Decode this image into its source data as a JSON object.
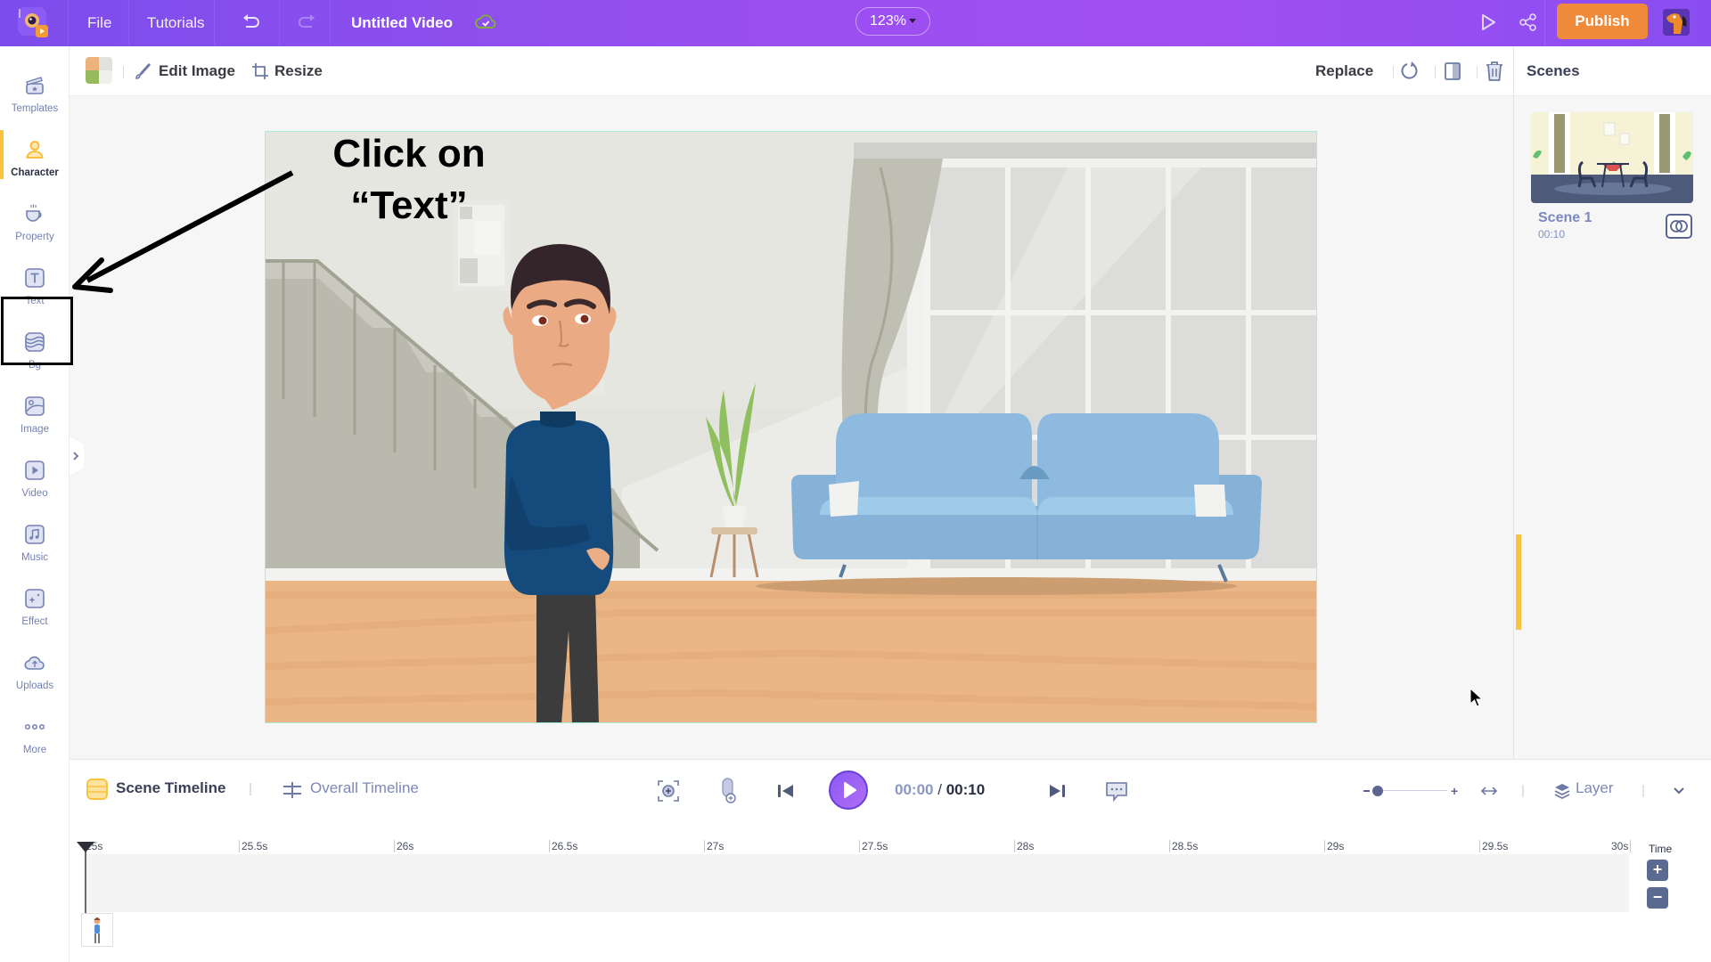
{
  "topbar": {
    "menu": {
      "file": "File",
      "tutorials": "Tutorials"
    },
    "project_title": "Untitled Video",
    "save_status_icon": "cloud-check-icon",
    "zoom_level": "123%",
    "publish_label": "Publish",
    "colors": {
      "gradient_start": "#7c4dec",
      "gradient_mid": "#a14ef2",
      "publish": "#ef8a3b"
    }
  },
  "sidebar": {
    "items": [
      {
        "id": "templates",
        "label": "Templates",
        "icon": "clapperboard-icon"
      },
      {
        "id": "character",
        "label": "Character",
        "icon": "person-icon",
        "active": true
      },
      {
        "id": "property",
        "label": "Property",
        "icon": "coffee-cup-icon"
      },
      {
        "id": "text",
        "label": "Text",
        "icon": "text-t-icon",
        "highlighted": true
      },
      {
        "id": "bg",
        "label": "Bg",
        "icon": "layers-wave-icon"
      },
      {
        "id": "image",
        "label": "Image",
        "icon": "image-icon"
      },
      {
        "id": "video",
        "label": "Video",
        "icon": "play-square-icon"
      },
      {
        "id": "music",
        "label": "Music",
        "icon": "music-note-icon"
      },
      {
        "id": "effect",
        "label": "Effect",
        "icon": "sparkle-icon"
      },
      {
        "id": "uploads",
        "label": "Uploads",
        "icon": "cloud-upload-icon"
      },
      {
        "id": "more",
        "label": "More",
        "icon": "dots-icon"
      }
    ],
    "active_color": "#f9c33e"
  },
  "toolbar": {
    "edit_image": "Edit Image",
    "resize": "Resize",
    "replace": "Replace"
  },
  "annotation": {
    "line1": "Click on",
    "line2": "“Text”"
  },
  "scenes": {
    "header": "Scenes",
    "items": [
      {
        "name": "Scene 1",
        "duration": "00:10"
      }
    ]
  },
  "timeline": {
    "scene_timeline_label": "Scene Timeline",
    "overall_timeline_label": "Overall Timeline",
    "current_time": "00:00",
    "separator": "/",
    "total_time": "00:10",
    "layer_label": "Layer",
    "time_label": "Time",
    "zoom_plus": "+",
    "zoom_minus": "−",
    "ticks": [
      "25s",
      "25.5s",
      "26s",
      "26.5s",
      "27s",
      "27.5s",
      "28s",
      "28.5s",
      "29s",
      "29.5s",
      "30s"
    ]
  }
}
